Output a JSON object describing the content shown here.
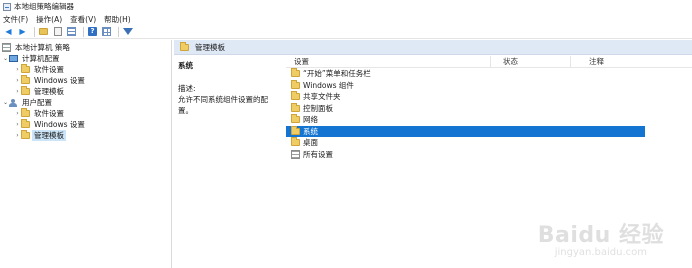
{
  "window": {
    "title": "本地组策略编辑器"
  },
  "menu": [
    "文件(F)",
    "操作(A)",
    "查看(V)",
    "帮助(H)"
  ],
  "tree": {
    "root": "本地计算机 策略",
    "computer_config": "计算机配置",
    "computer_children": [
      "软件设置",
      "Windows 设置",
      "管理模板"
    ],
    "user_config": "用户配置",
    "user_children": [
      "软件设置",
      "Windows 设置",
      "管理模板"
    ]
  },
  "right": {
    "header_title": "管理模板",
    "desc_title": "系统",
    "desc_label": "描述:",
    "desc_text": "允许不同系统组件设置的配置。",
    "columns": {
      "setting": "设置",
      "state": "状态",
      "note": "注释"
    },
    "items": [
      "“开始”菜单和任务栏",
      "Windows 组件",
      "共享文件夹",
      "控制面板",
      "网络",
      "系统",
      "桌面",
      "所有设置"
    ],
    "selected_index": 5
  },
  "watermark": {
    "logo": "Baidu 经验",
    "url": "jingyan.baidu.com"
  }
}
